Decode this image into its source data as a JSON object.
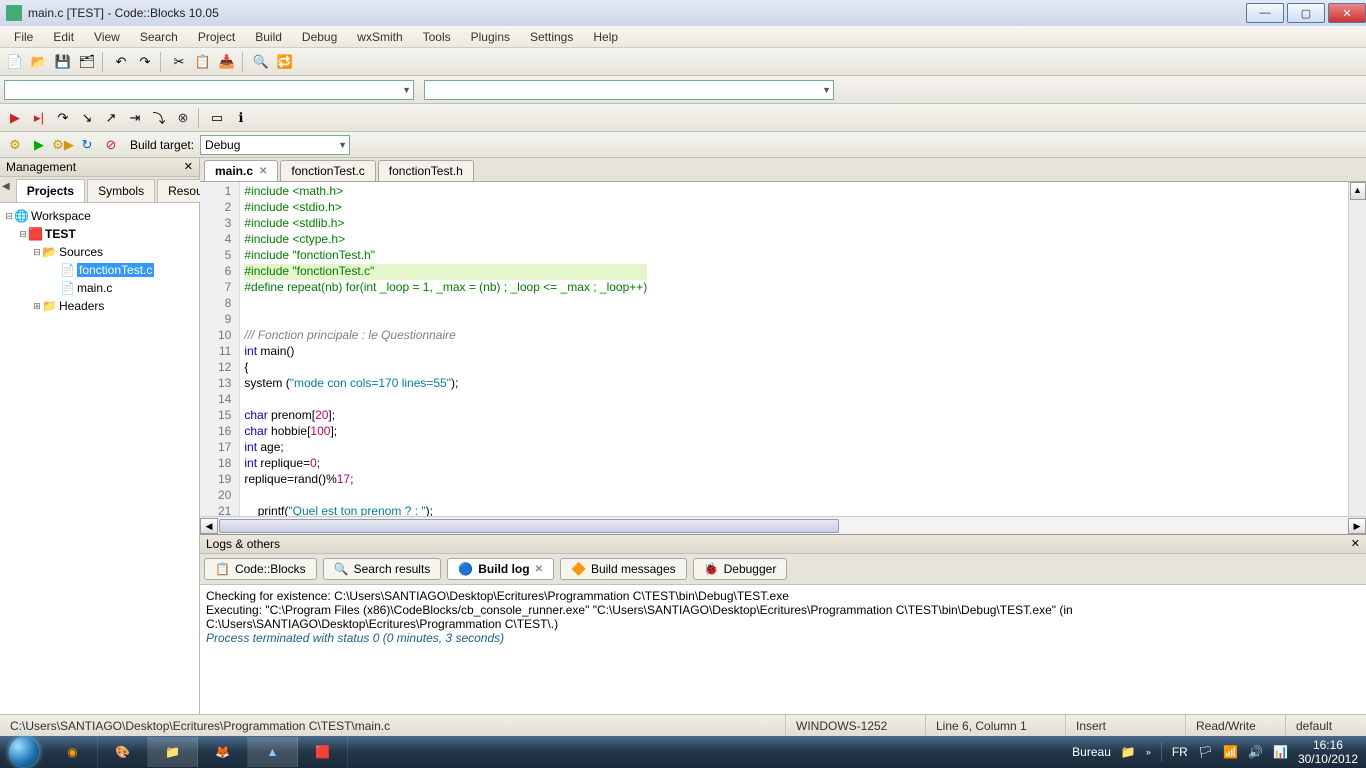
{
  "titlebar": {
    "title": "main.c [TEST] - Code::Blocks 10.05"
  },
  "menubar": [
    "File",
    "Edit",
    "View",
    "Search",
    "Project",
    "Build",
    "Debug",
    "wxSmith",
    "Tools",
    "Plugins",
    "Settings",
    "Help"
  ],
  "buildTarget": {
    "label": "Build target:",
    "value": "Debug"
  },
  "management": {
    "title": "Management",
    "tabs": [
      "Projects",
      "Symbols",
      "Resou"
    ],
    "tree": {
      "workspace": "Workspace",
      "project": "TEST",
      "sources": "Sources",
      "file1": "fonctionTest.c",
      "file2": "main.c",
      "headers": "Headers"
    }
  },
  "editorTabs": [
    {
      "label": "main.c",
      "active": true,
      "closable": true
    },
    {
      "label": "fonctionTest.c",
      "active": false,
      "closable": false
    },
    {
      "label": "fonctionTest.h",
      "active": false,
      "closable": false
    }
  ],
  "code": {
    "lines": [
      {
        "n": 1,
        "segs": [
          {
            "c": "inc",
            "t": "#include <math.h>"
          }
        ]
      },
      {
        "n": 2,
        "segs": [
          {
            "c": "inc",
            "t": "#include <stdio.h>"
          }
        ]
      },
      {
        "n": 3,
        "segs": [
          {
            "c": "inc",
            "t": "#include <stdlib.h>"
          }
        ]
      },
      {
        "n": 4,
        "segs": [
          {
            "c": "inc",
            "t": "#include <ctype.h>"
          }
        ]
      },
      {
        "n": 5,
        "segs": [
          {
            "c": "inc",
            "t": "#include \"fonctionTest.h\""
          }
        ]
      },
      {
        "n": 6,
        "segs": [
          {
            "c": "inc",
            "t": "#include \"fonctionTest.c\""
          }
        ],
        "hl": true
      },
      {
        "n": 7,
        "segs": [
          {
            "c": "inc",
            "t": "#define repeat(nb) for(int _loop = 1, _max = (nb) ; _loop <= _max ; _loop++)"
          }
        ]
      },
      {
        "n": 8,
        "segs": [
          {
            "c": "",
            "t": ""
          }
        ]
      },
      {
        "n": 9,
        "segs": [
          {
            "c": "",
            "t": ""
          }
        ]
      },
      {
        "n": 10,
        "segs": [
          {
            "c": "cmt",
            "t": "/// Fonction principale : le Questionnaire"
          }
        ]
      },
      {
        "n": 11,
        "segs": [
          {
            "c": "kw",
            "t": "int"
          },
          {
            "c": "",
            "t": " main"
          },
          {
            "c": "",
            "t": "()"
          }
        ]
      },
      {
        "n": 12,
        "segs": [
          {
            "c": "",
            "t": "{"
          }
        ],
        "fold": true
      },
      {
        "n": 13,
        "segs": [
          {
            "c": "",
            "t": "system "
          },
          {
            "c": "",
            "t": "("
          },
          {
            "c": "str",
            "t": "\"mode con cols=170 lines=55\""
          },
          {
            "c": "",
            "t": ");"
          }
        ]
      },
      {
        "n": 14,
        "segs": [
          {
            "c": "",
            "t": ""
          }
        ]
      },
      {
        "n": 15,
        "segs": [
          {
            "c": "kw",
            "t": "char"
          },
          {
            "c": "",
            "t": " prenom["
          },
          {
            "c": "num",
            "t": "20"
          },
          {
            "c": "",
            "t": "];"
          }
        ]
      },
      {
        "n": 16,
        "segs": [
          {
            "c": "kw",
            "t": "char"
          },
          {
            "c": "",
            "t": " hobbie["
          },
          {
            "c": "num",
            "t": "100"
          },
          {
            "c": "",
            "t": "];"
          }
        ]
      },
      {
        "n": 17,
        "segs": [
          {
            "c": "kw",
            "t": "int"
          },
          {
            "c": "",
            "t": " age;"
          }
        ]
      },
      {
        "n": 18,
        "segs": [
          {
            "c": "kw",
            "t": "int"
          },
          {
            "c": "",
            "t": " replique="
          },
          {
            "c": "num",
            "t": "0"
          },
          {
            "c": "",
            "t": ";"
          }
        ]
      },
      {
        "n": 19,
        "segs": [
          {
            "c": "",
            "t": "replique=rand()%"
          },
          {
            "c": "num",
            "t": "17"
          },
          {
            "c": "",
            "t": ";"
          }
        ]
      },
      {
        "n": 20,
        "segs": [
          {
            "c": "",
            "t": ""
          }
        ]
      },
      {
        "n": 21,
        "segs": [
          {
            "c": "",
            "t": "    printf("
          },
          {
            "c": "str",
            "t": "\"Quel est ton prenom ? : \""
          },
          {
            "c": "",
            "t": ");"
          }
        ]
      }
    ]
  },
  "logs": {
    "title": "Logs & others",
    "tabs": [
      {
        "icon": "📋",
        "label": "Code::Blocks",
        "active": false
      },
      {
        "icon": "🔍",
        "label": "Search results",
        "active": false
      },
      {
        "icon": "🔵",
        "label": "Build log",
        "active": true,
        "closable": true
      },
      {
        "icon": "🔶",
        "label": "Build messages",
        "active": false
      },
      {
        "icon": "🐞",
        "label": "Debugger",
        "active": false
      }
    ],
    "lines": [
      "Checking for existence: C:\\Users\\SANTIAGO\\Desktop\\Ecritures\\Programmation C\\TEST\\bin\\Debug\\TEST.exe",
      "Executing: \"C:\\Program Files (x86)\\CodeBlocks/cb_console_runner.exe\" \"C:\\Users\\SANTIAGO\\Desktop\\Ecritures\\Programmation C\\TEST\\bin\\Debug\\TEST.exe\"  (in C:\\Users\\SANTIAGO\\Desktop\\Ecritures\\Programmation C\\TEST\\.)"
    ],
    "term": "Process terminated with status 0 (0 minutes, 3 seconds)"
  },
  "status": {
    "path": "C:\\Users\\SANTIAGO\\Desktop\\Ecritures\\Programmation C\\TEST\\main.c",
    "encoding": "WINDOWS-1252",
    "pos": "Line 6, Column 1",
    "mode": "Insert",
    "rw": "Read/Write",
    "profile": "default"
  },
  "taskbar": {
    "desktop": "Bureau",
    "lang": "FR",
    "time": "16:16",
    "date": "30/10/2012"
  }
}
